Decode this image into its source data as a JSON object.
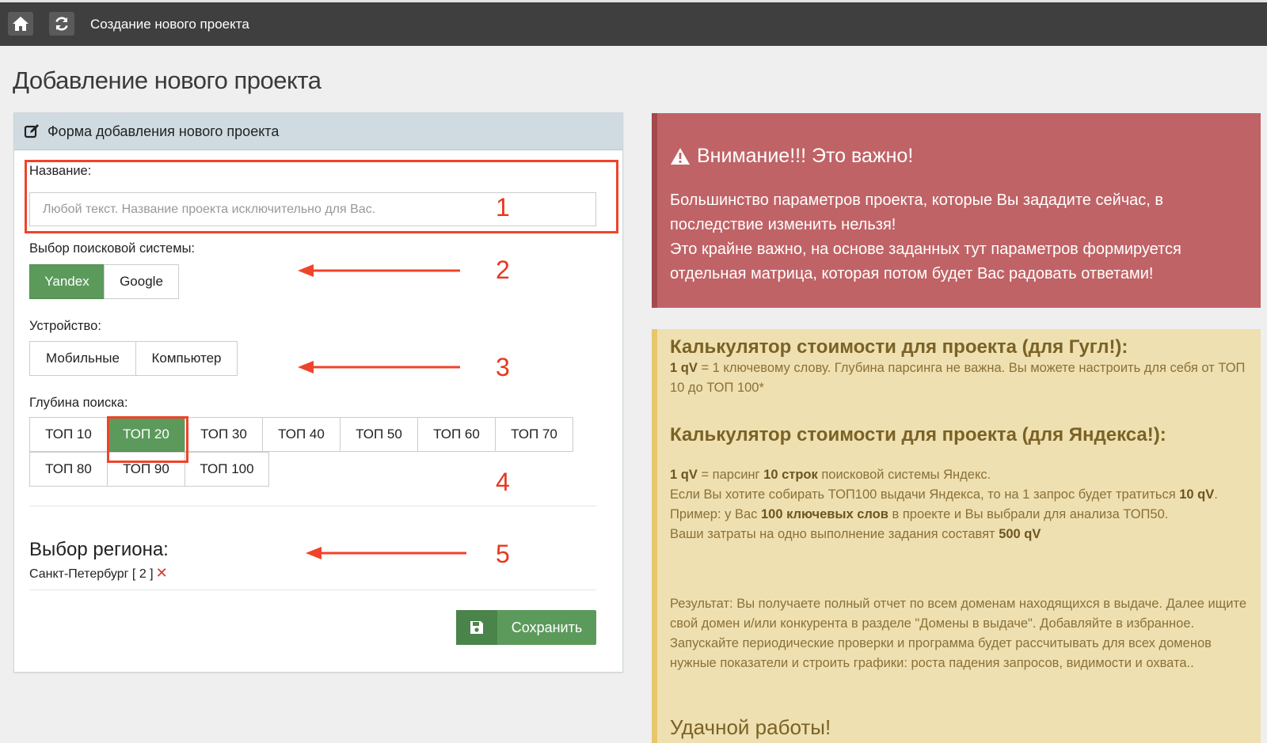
{
  "topbar": {
    "title": "Создание нового проекта",
    "home_icon": "home-icon",
    "refresh_icon": "refresh-icon"
  },
  "page_title": "Добавление нового проекта",
  "form": {
    "header": "Форма добавления нового проекта",
    "name_label": "Название:",
    "name_placeholder": "Любой текст. Название проекта исключительно для Вас.",
    "engine_label": "Выбор поисковой системы:",
    "engines": [
      {
        "label": "Yandex",
        "active": true
      },
      {
        "label": "Google",
        "active": false
      }
    ],
    "device_label": "Устройство:",
    "devices": [
      {
        "label": "Мобильные",
        "active": false
      },
      {
        "label": "Компьютер",
        "active": false
      }
    ],
    "depth_label": "Глубина поиска:",
    "depths": [
      {
        "label": "ТОП 10",
        "active": false
      },
      {
        "label": "ТОП 20",
        "active": true
      },
      {
        "label": "ТОП 30",
        "active": false
      },
      {
        "label": "ТОП 40",
        "active": false
      },
      {
        "label": "ТОП 50",
        "active": false
      },
      {
        "label": "ТОП 60",
        "active": false
      },
      {
        "label": "ТОП 70",
        "active": false
      },
      {
        "label": "ТОП 80",
        "active": false
      },
      {
        "label": "ТОП 90",
        "active": false
      },
      {
        "label": "ТОП 100",
        "active": false
      }
    ],
    "region_title": "Выбор региона:",
    "region_value": "Санкт-Петербург [ 2 ]",
    "region_remove": "✕",
    "save_label": "Сохранить"
  },
  "annotations": [
    "1",
    "2",
    "3",
    "4",
    "5"
  ],
  "alert_red": {
    "title": "Внимание!!! Это важно!",
    "p1": "Большинство параметров проекта, которые Вы зададите сейчас, в последствие изменить нельзя!",
    "p2": "Это крайне важно, на основе заданных тут параметров формируется отдельная матрица, которая потом будет Вас радовать ответами!"
  },
  "alert_yellow": {
    "google_title": "Калькулятор стоимости для проекта (для Гугл!):",
    "google_text_bold": "1 qV",
    "google_text": " = 1 ключевому слову. Глубина парсинга не важна. Вы можете настроить для себя от ТОП 10 до ТОП 100*",
    "yandex_title": "Калькулятор стоимости для проекта (для Яндекса!):",
    "y1_b1": "1 qV",
    "y1_t1": " = парсинг ",
    "y1_b2": "10 строк",
    "y1_t2": " поисковой системы Яндекс.",
    "y2_t1": "Если Вы хотите собирать ТОП100 выдачи Яндекса, то на 1 запрос будет тратиться ",
    "y2_b1": "10 qV",
    "y2_t2": ".",
    "y3_t1": "Пример: у Вас ",
    "y3_b1": "100 ключевых слов",
    "y3_t2": " в проекте и Вы выбрали для анализа ТОП50.",
    "y4_t1": "Ваши затраты на одно выполнение задания составят ",
    "y4_b1": "500 qV",
    "result": "Результат: Вы получаете полный отчет по всем доменам находящихся в выдаче. Далее ищите свой домен и/или конкурента в разделе \"Домены в выдаче\". Добавляйте в избранное. Запускайте периодические проверки и программа будет рассчитывать для всех доменов нужные показатели и строить графики: роста падения запросов, видимости и охвата..",
    "goodbye": "Удачной работы!"
  },
  "colors": {
    "active_green": "#5c9a5c",
    "alert_red": "#c06366",
    "alert_yellow": "#efe0b1",
    "annotation_red": "#f0432a"
  }
}
